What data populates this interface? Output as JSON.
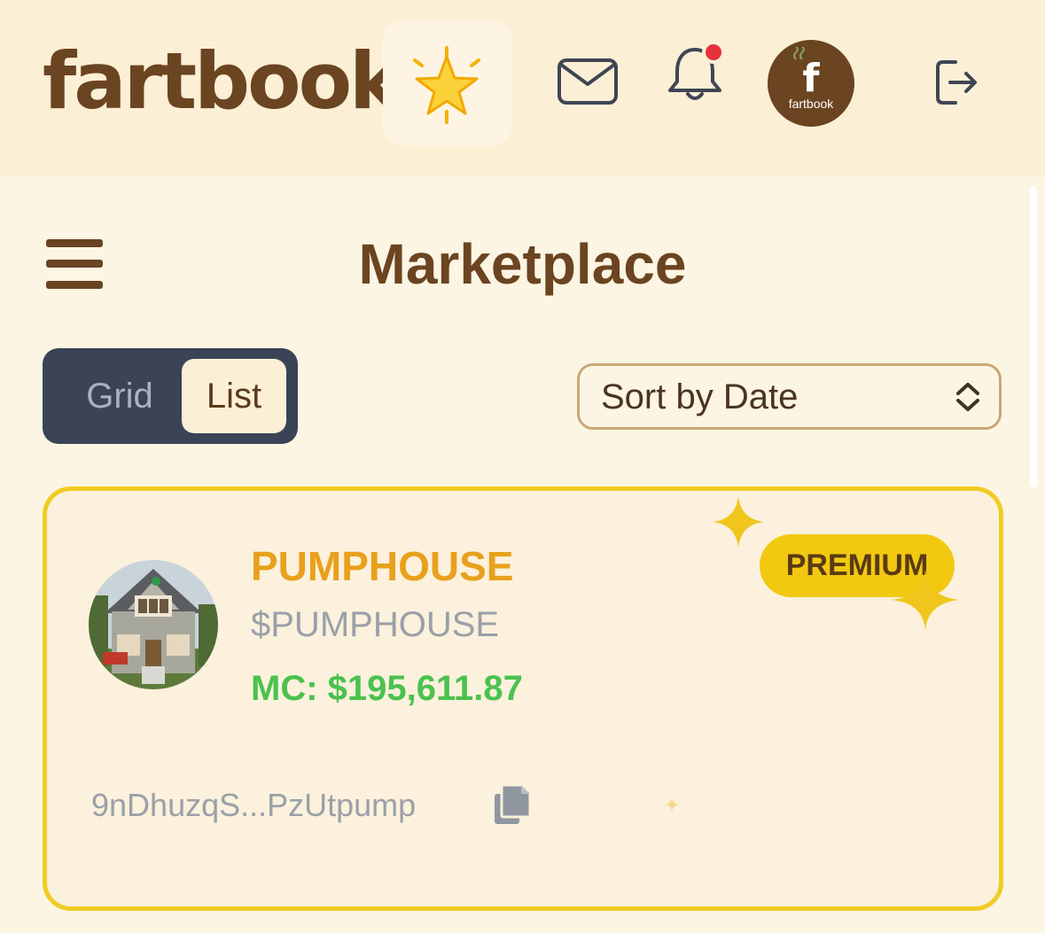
{
  "header": {
    "brand": "fartbook",
    "avatar": {
      "letter": "f",
      "caption": "fartbook"
    },
    "notification_dot": true
  },
  "icons": {
    "star": "glowing-star-icon",
    "mail": "mail-icon",
    "bell": "bell-icon",
    "logout": "logout-icon",
    "menu": "hamburger-menu-icon",
    "sort": "chevron-up-down-icon",
    "copy": "copy-icon"
  },
  "page": {
    "title": "Marketplace"
  },
  "view_toggle": {
    "options": [
      "Grid",
      "List"
    ],
    "selected": "List"
  },
  "sort": {
    "selected": "Sort by Date"
  },
  "listing": {
    "name": "PUMPHOUSE",
    "ticker": "$PUMPHOUSE",
    "market_cap": "MC: $195,611.87",
    "badge": "PREMIUM",
    "address": "9nDhuzqS...PzUtpump"
  },
  "colors": {
    "brand": "#6b4421",
    "header_bg": "#fbefd6",
    "page_bg": "#fdf5e3",
    "card_border": "#f0cc23",
    "premium": "#f2c811",
    "token_name": "#e9a01c",
    "market_cap": "#4ac24e",
    "toggle_bg": "#3b4356",
    "notification": "#e8313a"
  }
}
